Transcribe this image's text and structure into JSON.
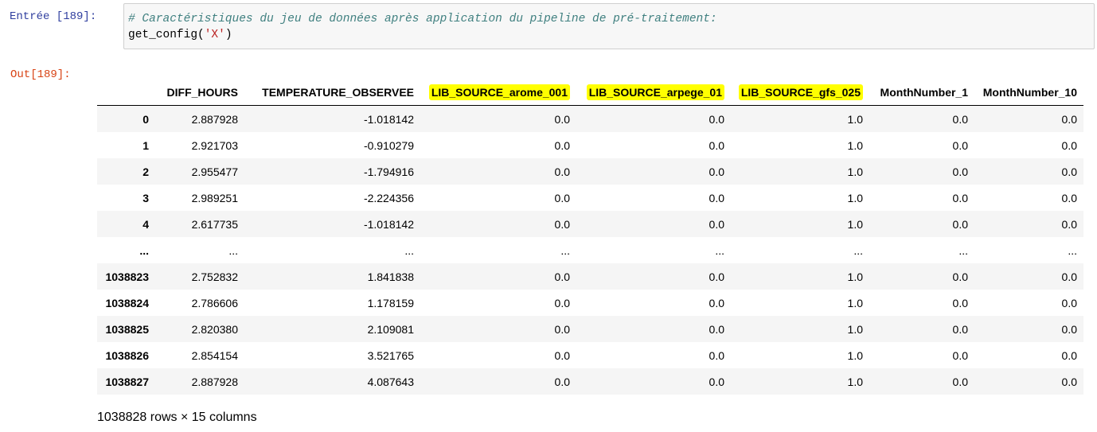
{
  "input_prompt": "Entrée [189]:",
  "code": {
    "comment": "# Caractéristiques du jeu de données après application du pipeline de pré-traitement:",
    "call_prefix": "get_config(",
    "call_arg": "'X'",
    "call_suffix": ")"
  },
  "output_prompt": "Out[189]:",
  "table": {
    "columns": [
      "",
      "DIFF_HOURS",
      "TEMPERATURE_OBSERVEE",
      "LIB_SOURCE_arome_001",
      "LIB_SOURCE_arpege_01",
      "LIB_SOURCE_gfs_025",
      "MonthNumber_1",
      "MonthNumber_10"
    ],
    "rows": [
      [
        "0",
        "2.887928",
        "-1.018142",
        "0.0",
        "0.0",
        "1.0",
        "0.0",
        "0.0"
      ],
      [
        "1",
        "2.921703",
        "-0.910279",
        "0.0",
        "0.0",
        "1.0",
        "0.0",
        "0.0"
      ],
      [
        "2",
        "2.955477",
        "-1.794916",
        "0.0",
        "0.0",
        "1.0",
        "0.0",
        "0.0"
      ],
      [
        "3",
        "2.989251",
        "-2.224356",
        "0.0",
        "0.0",
        "1.0",
        "0.0",
        "0.0"
      ],
      [
        "4",
        "2.617735",
        "-1.018142",
        "0.0",
        "0.0",
        "1.0",
        "0.0",
        "0.0"
      ],
      [
        "...",
        "...",
        "...",
        "...",
        "...",
        "...",
        "...",
        "..."
      ],
      [
        "1038823",
        "2.752832",
        "1.841838",
        "0.0",
        "0.0",
        "1.0",
        "0.0",
        "0.0"
      ],
      [
        "1038824",
        "2.786606",
        "1.178159",
        "0.0",
        "0.0",
        "1.0",
        "0.0",
        "0.0"
      ],
      [
        "1038825",
        "2.820380",
        "2.109081",
        "0.0",
        "0.0",
        "1.0",
        "0.0",
        "0.0"
      ],
      [
        "1038826",
        "2.854154",
        "3.521765",
        "0.0",
        "0.0",
        "1.0",
        "0.0",
        "0.0"
      ],
      [
        "1038827",
        "2.887928",
        "4.087643",
        "0.0",
        "0.0",
        "1.0",
        "0.0",
        "0.0"
      ]
    ]
  },
  "footer": "1038828 rows × 15 columns",
  "colors": {
    "highlight": "#ffff00",
    "input_prompt": "#303f9f",
    "output_prompt": "#d84315",
    "comment": "#408080",
    "string": "#ba2121"
  }
}
